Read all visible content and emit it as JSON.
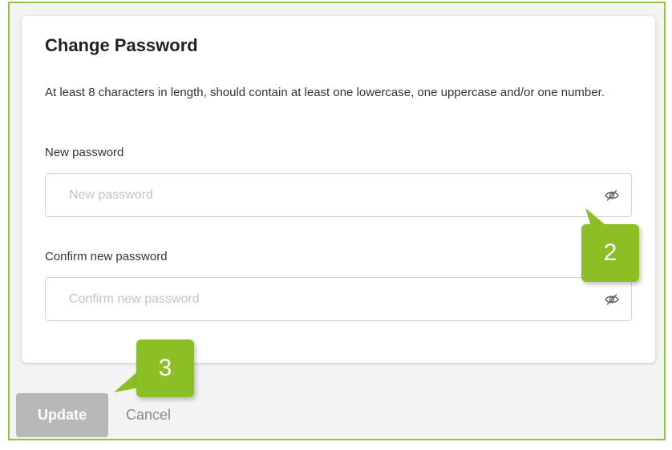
{
  "card": {
    "title": "Change Password",
    "hint": "At least 8 characters in length, should contain at least one lowercase, one uppercase and/or one number."
  },
  "new_password": {
    "label": "New password",
    "placeholder": "New password",
    "value": "",
    "toggle_icon": "eye-slash-icon"
  },
  "confirm_password": {
    "label": "Confirm new password",
    "placeholder": "Confirm new password",
    "value": "",
    "toggle_icon": "eye-slash-icon"
  },
  "actions": {
    "update_label": "Update",
    "cancel_label": "Cancel"
  },
  "callouts": [
    {
      "number": "2"
    },
    {
      "number": "3"
    }
  ],
  "colors": {
    "frame_border": "#8cc63f",
    "callout_bg": "#8cbf26",
    "update_button_disabled": "#b8b8b8"
  }
}
